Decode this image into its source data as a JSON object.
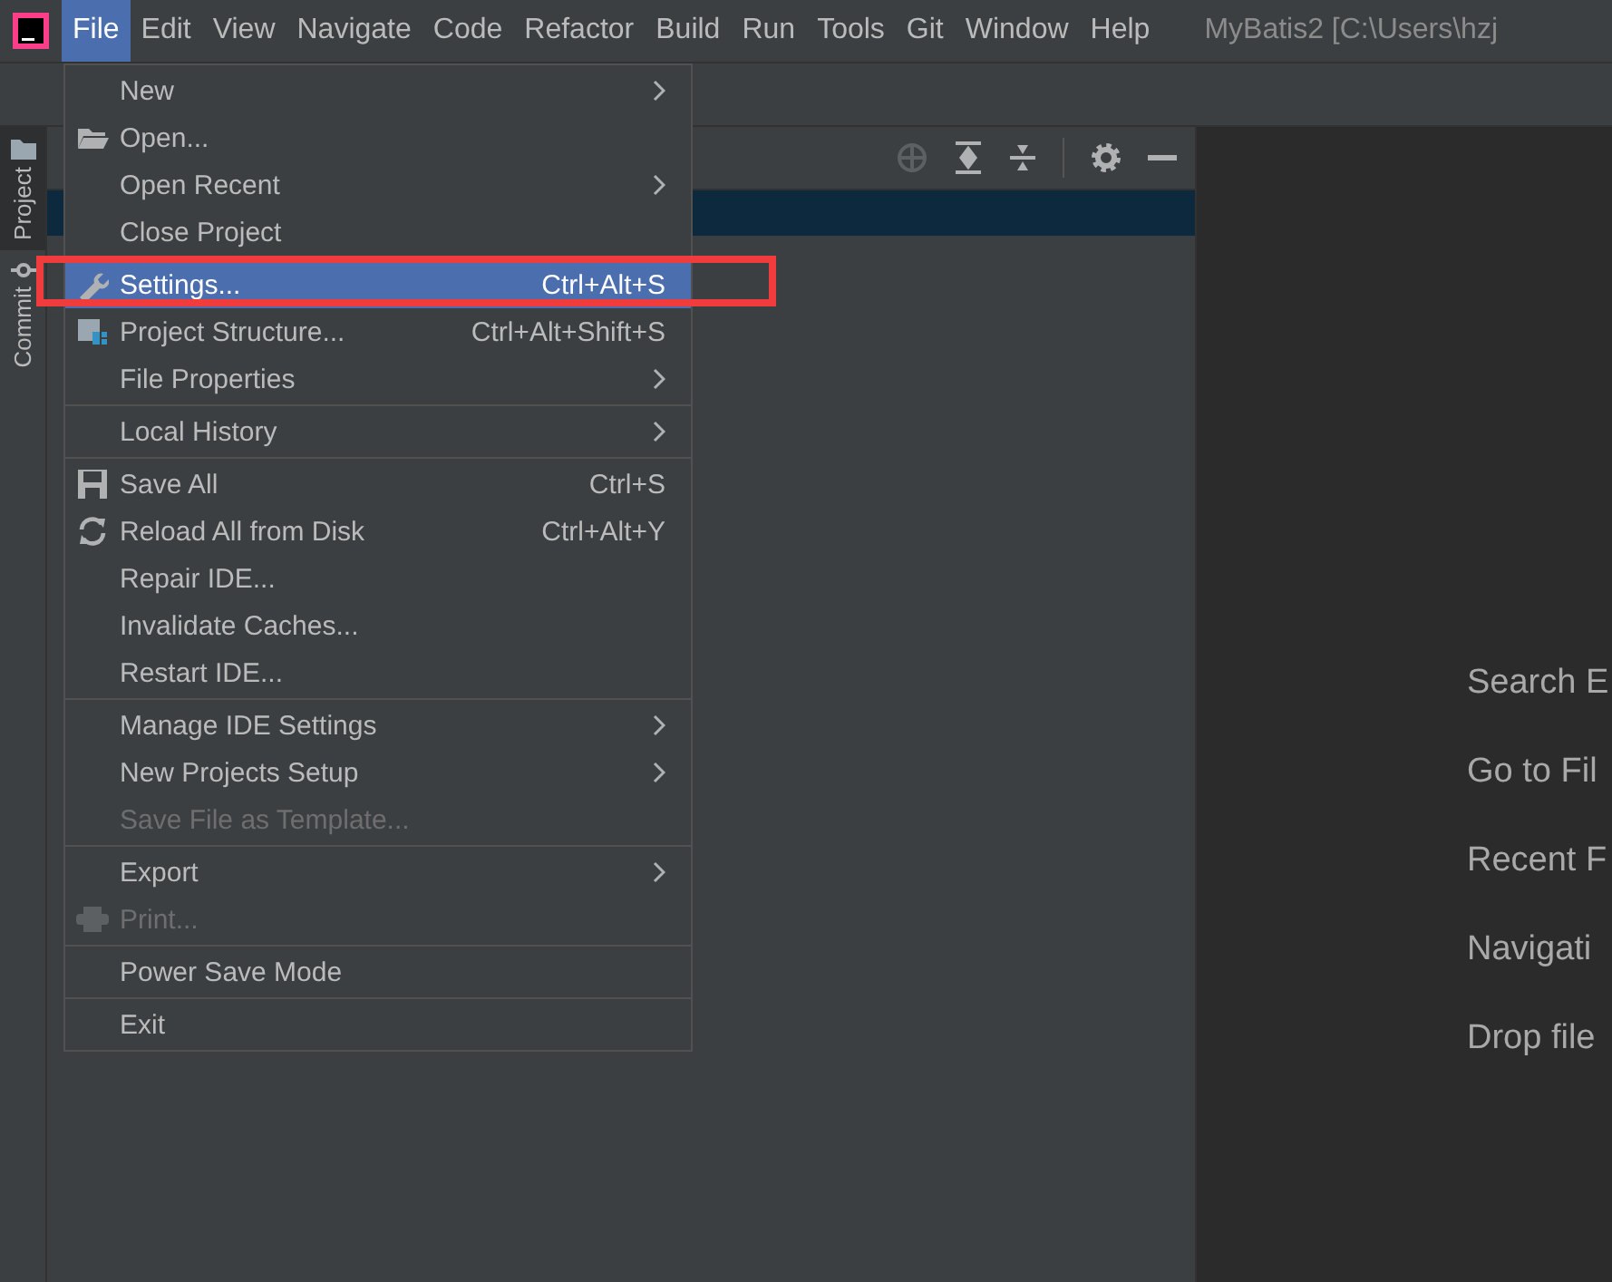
{
  "menubar": {
    "items": [
      {
        "label": "File",
        "selected": true
      },
      {
        "label": "Edit",
        "selected": false
      },
      {
        "label": "View",
        "selected": false
      },
      {
        "label": "Navigate",
        "selected": false
      },
      {
        "label": "Code",
        "selected": false
      },
      {
        "label": "Refactor",
        "selected": false
      },
      {
        "label": "Build",
        "selected": false
      },
      {
        "label": "Run",
        "selected": false
      },
      {
        "label": "Tools",
        "selected": false
      },
      {
        "label": "Git",
        "selected": false
      },
      {
        "label": "Window",
        "selected": false
      },
      {
        "label": "Help",
        "selected": false
      }
    ],
    "title": "MyBatis2 [C:\\Users\\hzj"
  },
  "side_tabs": [
    {
      "label": "Project",
      "selected": true
    },
    {
      "label": "Commit",
      "selected": false
    }
  ],
  "file_menu": {
    "groups": [
      [
        {
          "label": "New",
          "submenu": true,
          "disabled": false,
          "selected": false,
          "kind": "plain"
        },
        {
          "label": "Open...",
          "submenu": false,
          "disabled": false,
          "selected": false,
          "kind": "open"
        },
        {
          "label": "Open Recent",
          "submenu": true,
          "disabled": false,
          "selected": false,
          "kind": "plain"
        },
        {
          "label": "Close Project",
          "submenu": false,
          "disabled": false,
          "selected": false,
          "kind": "plain"
        }
      ],
      [
        {
          "label": "Settings...",
          "shortcut": "Ctrl+Alt+S",
          "submenu": false,
          "disabled": false,
          "selected": true,
          "kind": "settings"
        },
        {
          "label": "Project Structure...",
          "shortcut": "Ctrl+Alt+Shift+S",
          "submenu": false,
          "disabled": false,
          "selected": false,
          "kind": "structure"
        },
        {
          "label": "File Properties",
          "submenu": true,
          "disabled": false,
          "selected": false,
          "kind": "plain"
        }
      ],
      [
        {
          "label": "Local History",
          "submenu": true,
          "disabled": false,
          "selected": false,
          "kind": "plain"
        }
      ],
      [
        {
          "label": "Save All",
          "shortcut": "Ctrl+S",
          "submenu": false,
          "disabled": false,
          "selected": false,
          "kind": "save"
        },
        {
          "label": "Reload All from Disk",
          "shortcut": "Ctrl+Alt+Y",
          "submenu": false,
          "disabled": false,
          "selected": false,
          "kind": "reload"
        },
        {
          "label": "Repair IDE...",
          "submenu": false,
          "disabled": false,
          "selected": false,
          "kind": "plain"
        },
        {
          "label": "Invalidate Caches...",
          "submenu": false,
          "disabled": false,
          "selected": false,
          "kind": "plain"
        },
        {
          "label": "Restart IDE...",
          "submenu": false,
          "disabled": false,
          "selected": false,
          "kind": "plain"
        }
      ],
      [
        {
          "label": "Manage IDE Settings",
          "submenu": true,
          "disabled": false,
          "selected": false,
          "kind": "plain"
        },
        {
          "label": "New Projects Setup",
          "submenu": true,
          "disabled": false,
          "selected": false,
          "kind": "plain"
        },
        {
          "label": "Save File as Template...",
          "submenu": false,
          "disabled": true,
          "selected": false,
          "kind": "plain"
        }
      ],
      [
        {
          "label": "Export",
          "submenu": true,
          "disabled": false,
          "selected": false,
          "kind": "plain"
        },
        {
          "label": "Print...",
          "submenu": false,
          "disabled": true,
          "selected": false,
          "kind": "print"
        }
      ],
      [
        {
          "label": "Power Save Mode",
          "submenu": false,
          "disabled": false,
          "selected": false,
          "kind": "plain"
        }
      ],
      [
        {
          "label": "Exit",
          "submenu": false,
          "disabled": false,
          "selected": false,
          "kind": "plain"
        }
      ]
    ]
  },
  "welcome_hints": [
    "Search E",
    "Go to Fil",
    "Recent F",
    "Navigati",
    "Drop file"
  ]
}
